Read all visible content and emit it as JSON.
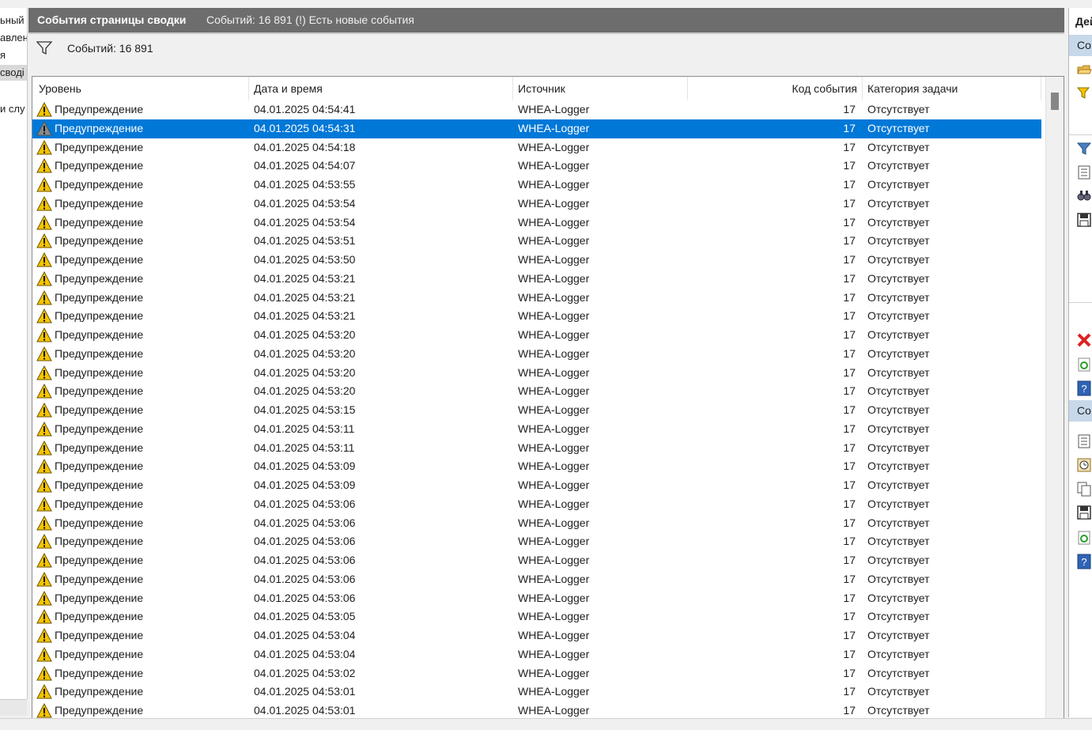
{
  "left_tree": {
    "items": [
      {
        "label": "ьный",
        "selected": false
      },
      {
        "label": "авлен",
        "selected": false
      },
      {
        "label": "я",
        "selected": false
      },
      {
        "label": "своді",
        "selected": true
      },
      {
        "label": "и слу",
        "selected": false
      }
    ]
  },
  "title_bar": {
    "title": "События страницы сводки",
    "subtitle": "Событий: 16 891 (!) Есть новые события"
  },
  "filter": {
    "icon": "filter-icon",
    "text": "Событий: 16 891"
  },
  "grid": {
    "columns": {
      "level": "Уровень",
      "datetime": "Дата и время",
      "source": "Источник",
      "event_id": "Код события",
      "category": "Категория задачи"
    },
    "selected_index": 1,
    "rows": [
      {
        "level": "Предупреждение",
        "datetime": "04.01.2025 04:54:41",
        "source": "WHEA-Logger",
        "event_id": "17",
        "category": "Отсутствует"
      },
      {
        "level": "Предупреждение",
        "datetime": "04.01.2025 04:54:31",
        "source": "WHEA-Logger",
        "event_id": "17",
        "category": "Отсутствует"
      },
      {
        "level": "Предупреждение",
        "datetime": "04.01.2025 04:54:18",
        "source": "WHEA-Logger",
        "event_id": "17",
        "category": "Отсутствует"
      },
      {
        "level": "Предупреждение",
        "datetime": "04.01.2025 04:54:07",
        "source": "WHEA-Logger",
        "event_id": "17",
        "category": "Отсутствует"
      },
      {
        "level": "Предупреждение",
        "datetime": "04.01.2025 04:53:55",
        "source": "WHEA-Logger",
        "event_id": "17",
        "category": "Отсутствует"
      },
      {
        "level": "Предупреждение",
        "datetime": "04.01.2025 04:53:54",
        "source": "WHEA-Logger",
        "event_id": "17",
        "category": "Отсутствует"
      },
      {
        "level": "Предупреждение",
        "datetime": "04.01.2025 04:53:54",
        "source": "WHEA-Logger",
        "event_id": "17",
        "category": "Отсутствует"
      },
      {
        "level": "Предупреждение",
        "datetime": "04.01.2025 04:53:51",
        "source": "WHEA-Logger",
        "event_id": "17",
        "category": "Отсутствует"
      },
      {
        "level": "Предупреждение",
        "datetime": "04.01.2025 04:53:50",
        "source": "WHEA-Logger",
        "event_id": "17",
        "category": "Отсутствует"
      },
      {
        "level": "Предупреждение",
        "datetime": "04.01.2025 04:53:21",
        "source": "WHEA-Logger",
        "event_id": "17",
        "category": "Отсутствует"
      },
      {
        "level": "Предупреждение",
        "datetime": "04.01.2025 04:53:21",
        "source": "WHEA-Logger",
        "event_id": "17",
        "category": "Отсутствует"
      },
      {
        "level": "Предупреждение",
        "datetime": "04.01.2025 04:53:21",
        "source": "WHEA-Logger",
        "event_id": "17",
        "category": "Отсутствует"
      },
      {
        "level": "Предупреждение",
        "datetime": "04.01.2025 04:53:20",
        "source": "WHEA-Logger",
        "event_id": "17",
        "category": "Отсутствует"
      },
      {
        "level": "Предупреждение",
        "datetime": "04.01.2025 04:53:20",
        "source": "WHEA-Logger",
        "event_id": "17",
        "category": "Отсутствует"
      },
      {
        "level": "Предупреждение",
        "datetime": "04.01.2025 04:53:20",
        "source": "WHEA-Logger",
        "event_id": "17",
        "category": "Отсутствует"
      },
      {
        "level": "Предупреждение",
        "datetime": "04.01.2025 04:53:20",
        "source": "WHEA-Logger",
        "event_id": "17",
        "category": "Отсутствует"
      },
      {
        "level": "Предупреждение",
        "datetime": "04.01.2025 04:53:15",
        "source": "WHEA-Logger",
        "event_id": "17",
        "category": "Отсутствует"
      },
      {
        "level": "Предупреждение",
        "datetime": "04.01.2025 04:53:11",
        "source": "WHEA-Logger",
        "event_id": "17",
        "category": "Отсутствует"
      },
      {
        "level": "Предупреждение",
        "datetime": "04.01.2025 04:53:11",
        "source": "WHEA-Logger",
        "event_id": "17",
        "category": "Отсутствует"
      },
      {
        "level": "Предупреждение",
        "datetime": "04.01.2025 04:53:09",
        "source": "WHEA-Logger",
        "event_id": "17",
        "category": "Отсутствует"
      },
      {
        "level": "Предупреждение",
        "datetime": "04.01.2025 04:53:09",
        "source": "WHEA-Logger",
        "event_id": "17",
        "category": "Отсутствует"
      },
      {
        "level": "Предупреждение",
        "datetime": "04.01.2025 04:53:06",
        "source": "WHEA-Logger",
        "event_id": "17",
        "category": "Отсутствует"
      },
      {
        "level": "Предупреждение",
        "datetime": "04.01.2025 04:53:06",
        "source": "WHEA-Logger",
        "event_id": "17",
        "category": "Отсутствует"
      },
      {
        "level": "Предупреждение",
        "datetime": "04.01.2025 04:53:06",
        "source": "WHEA-Logger",
        "event_id": "17",
        "category": "Отсутствует"
      },
      {
        "level": "Предупреждение",
        "datetime": "04.01.2025 04:53:06",
        "source": "WHEA-Logger",
        "event_id": "17",
        "category": "Отсутствует"
      },
      {
        "level": "Предупреждение",
        "datetime": "04.01.2025 04:53:06",
        "source": "WHEA-Logger",
        "event_id": "17",
        "category": "Отсутствует"
      },
      {
        "level": "Предупреждение",
        "datetime": "04.01.2025 04:53:06",
        "source": "WHEA-Logger",
        "event_id": "17",
        "category": "Отсутствует"
      },
      {
        "level": "Предупреждение",
        "datetime": "04.01.2025 04:53:05",
        "source": "WHEA-Logger",
        "event_id": "17",
        "category": "Отсутствует"
      },
      {
        "level": "Предупреждение",
        "datetime": "04.01.2025 04:53:04",
        "source": "WHEA-Logger",
        "event_id": "17",
        "category": "Отсутствует"
      },
      {
        "level": "Предупреждение",
        "datetime": "04.01.2025 04:53:04",
        "source": "WHEA-Logger",
        "event_id": "17",
        "category": "Отсутствует"
      },
      {
        "level": "Предупреждение",
        "datetime": "04.01.2025 04:53:02",
        "source": "WHEA-Logger",
        "event_id": "17",
        "category": "Отсутствует"
      },
      {
        "level": "Предупреждение",
        "datetime": "04.01.2025 04:53:01",
        "source": "WHEA-Logger",
        "event_id": "17",
        "category": "Отсутствует"
      },
      {
        "level": "Предупреждение",
        "datetime": "04.01.2025 04:53:01",
        "source": "WHEA-Logger",
        "event_id": "17",
        "category": "Отсутствует"
      }
    ]
  },
  "actions_pane": {
    "header": "Дей",
    "section1": "Со",
    "section2": "Со",
    "section1_icons": [
      "open-folder-icon",
      "create-view-icon",
      "filter-icon",
      "properties-icon",
      "find-icon",
      "save-icon",
      "delete-icon",
      "refresh-icon",
      "help-icon"
    ],
    "section2_icons": [
      "event-properties-icon",
      "attach-task-icon",
      "copy-icon",
      "save-icon",
      "refresh-icon",
      "help-icon"
    ]
  },
  "colors": {
    "title_bar": "#6d6d6d",
    "selection": "#0078d7",
    "warning": "#f5c400",
    "section_header": "#c7d8ea"
  }
}
